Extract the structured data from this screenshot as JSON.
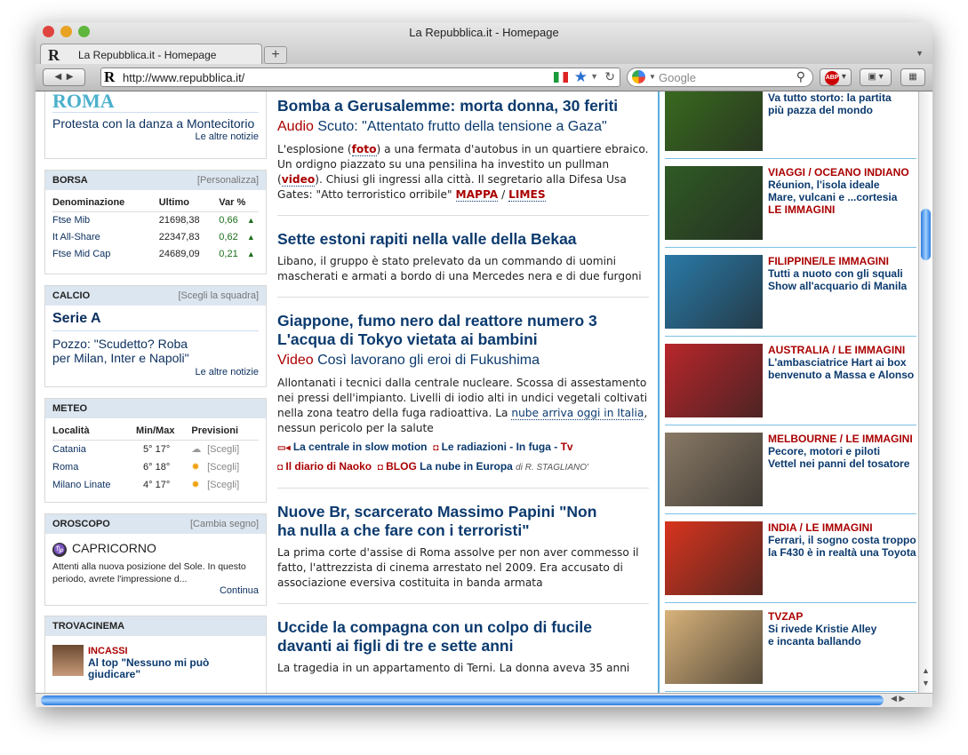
{
  "window": {
    "title": "La Repubblica.it - Homepage"
  },
  "tab": {
    "label": "La Repubblica.it - Homepage",
    "new_tab": "+"
  },
  "toolbar": {
    "url": "http://www.repubblica.it/",
    "search_placeholder": "Google",
    "abp": "ABP"
  },
  "left": {
    "roma": {
      "logo": "ROMA",
      "headline": "Protesta con la danza a Montecitorio",
      "more": "Le altre notizie"
    },
    "borsa": {
      "title": "BORSA",
      "link": "[Personalizza]",
      "headers": [
        "Denominazione",
        "Ultimo",
        "Var %"
      ],
      "rows": [
        {
          "name": "Ftse Mib",
          "last": "21698,38",
          "var": "0,66"
        },
        {
          "name": "It All-Share",
          "last": "22347,83",
          "var": "0,62"
        },
        {
          "name": "Ftse Mid Cap",
          "last": "24689,09",
          "var": "0,21"
        }
      ]
    },
    "calcio": {
      "title": "CALCIO",
      "link": "[Scegli la squadra]",
      "league": "Serie A",
      "headline": "Pozzo: \"Scudetto? Roba per Milan, Inter e Napoli\"",
      "more": "Le altre notizie"
    },
    "meteo": {
      "title": "METEO",
      "headers": [
        "Località",
        "Min/Max",
        "Previsioni"
      ],
      "rows": [
        {
          "city": "Catania",
          "temps": "5° 17°",
          "icon": "cloud-sun",
          "link": "[Scegli]"
        },
        {
          "city": "Roma",
          "temps": "6° 18°",
          "icon": "sun",
          "link": "[Scegli]"
        },
        {
          "city": "Milano Linate",
          "temps": "4° 17°",
          "icon": "sun",
          "link": "[Scegli]"
        }
      ]
    },
    "oroscopo": {
      "title": "OROSCOPO",
      "link": "[Cambia segno]",
      "sign": "CAPRICORNO",
      "text": "Attenti alla nuova posizione del Sole. In questo periodo, avrete l'impressione d...",
      "more": "Continua"
    },
    "trovacinema": {
      "title": "TROVACINEMA",
      "kicker": "INCASSI",
      "headline": "Al top \"Nessuno mi può giudicare\""
    }
  },
  "center": [
    {
      "headline": "Bomba a Gerusalemme: morta donna, 30 feriti",
      "sub_tag": "Audio",
      "sub": "Scuto: \"Attentato frutto della tensione a Gaza\"",
      "body_a": "L'esplosione (",
      "link1": "foto",
      "body_b": ") a una fermata d'autobus in un quartiere ebraico. Un ordigno piazzato su una pensilina ha investito un pullman (",
      "link2": "video",
      "body_c": "). Chiusi gli ingressi alla città. Il segretario alla Difesa Usa Gates: \"Atto terroristico orribile\" ",
      "link3": "MAPPA",
      "sep": " / ",
      "link4": "LIMES"
    },
    {
      "headline": "Sette estoni rapiti nella valle della Bekaa",
      "body": "Libano, il gruppo è stato prelevato da un commando di uomini mascherati e armati a bordo di una Mercedes nera e di due furgoni"
    },
    {
      "headline": "Giappone, fumo nero dal reattore numero 3 L'acqua di Tokyo vietata ai bambini",
      "sub_tag": "Video",
      "sub": "Così lavorano gli eroi di Fukushima",
      "body": "Allontanati i tecnici dalla centrale nucleare. Scossa di assestamento nei pressi dell'impianto. Livelli di iodio alti in undici vegetali coltivati nella zona teatro della fuga radioattiva.  La ",
      "link": "nube arriva oggi in Italia",
      "body_b": ", nessun pericolo per la salute",
      "rel1": "La centrale in slow motion",
      "rel2": "Le radiazioni - In fuga",
      "rel_sep": " - ",
      "rel3": "Tv",
      "rel4": "Il diario di Naoko",
      "rel5_tag": "BLOG",
      "rel5": "La nube in Europa",
      "byline": "di R. STAGLIANO'"
    },
    {
      "headline": "Nuove Br, scarcerato Massimo Papini \"Non ha nulla a che fare con i terroristi\"",
      "body": "La prima corte d'assise di Roma assolve per non aver commesso il fatto, l'attrezzista di cinema arrestato nel 2009. Era accusato di associazione eversiva costituita in banda armata"
    },
    {
      "headline": "Uccide la compagna con un colpo di fucile davanti ai figli di tre e sette anni",
      "body": "La tragedia in un appartamento di Terni. La donna aveva 35 anni"
    }
  ],
  "right": [
    {
      "kicker": "",
      "lines": [
        "Va tutto storto: la partita",
        "più pazza del mondo"
      ],
      "color": "#3a6e1e"
    },
    {
      "kicker": "VIAGGI / OCEANO INDIANO",
      "lines": [
        "Réunion, l'isola ideale",
        "Mare, vulcani e ...cortesia"
      ],
      "tail": "LE IMMAGINI",
      "color": "#2f5a24"
    },
    {
      "kicker": "FILIPPINE/LE IMMAGINI",
      "lines": [
        "Tutti a nuoto con gli squali",
        "Show all'acquario di Manila"
      ],
      "color": "#2a7aa8"
    },
    {
      "kicker": "AUSTRALIA / LE IMMAGINI",
      "lines": [
        "L'ambasciatrice Hart ai box",
        "benvenuto a Massa e Alonso"
      ],
      "color": "#b8262a"
    },
    {
      "kicker": "MELBOURNE / LE IMMAGINI",
      "lines": [
        "Pecore, motori e piloti",
        "Vettel nei panni del tosatore"
      ],
      "color": "#8a7a66"
    },
    {
      "kicker": "INDIA / LE IMMAGINI",
      "lines": [
        "Ferrari, il sogno costa troppo",
        "la F430 è in realtà una Toyota"
      ],
      "color": "#d8341e"
    },
    {
      "kicker": "TVZAP",
      "lines": [
        "Si rivede Kristie Alley",
        "e incanta ballando"
      ],
      "color": "#d8b27a"
    }
  ]
}
